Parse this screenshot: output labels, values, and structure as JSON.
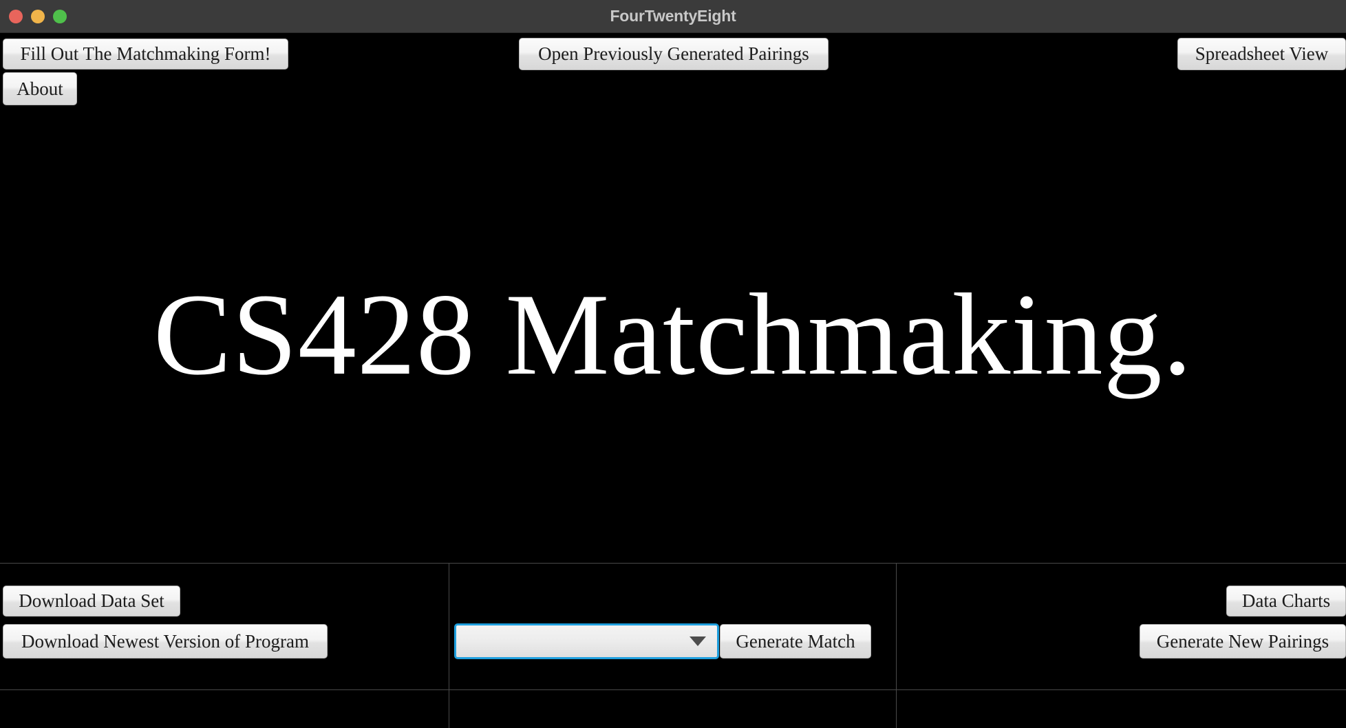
{
  "window": {
    "title": "FourTwentyEight",
    "traffic_lights": [
      {
        "name": "close",
        "color": "#e8655c"
      },
      {
        "name": "minimize",
        "color": "#f0b44a"
      },
      {
        "name": "maximize",
        "color": "#4fc04b"
      }
    ]
  },
  "toolbar": {
    "fill_form_label": "Fill Out The Matchmaking Form!",
    "about_label": "About",
    "open_previous_label": "Open Previously Generated Pairings",
    "spreadsheet_label": "Spreadsheet View"
  },
  "hero": {
    "title": "CS428 Matchmaking.",
    "background": "#000000",
    "text_color": "#ffffff"
  },
  "bottom": {
    "download_data_label": "Download Data Set",
    "download_program_label": "Download Newest Version of Program",
    "data_charts_label": "Data Charts",
    "generate_new_pairings_label": "Generate New Pairings",
    "generate_match_label": "Generate Match",
    "pairing_select": {
      "value": "",
      "placeholder": "",
      "focused": true,
      "focus_color": "#1e9fde",
      "arrow_icon": "chevron-down-icon"
    }
  }
}
